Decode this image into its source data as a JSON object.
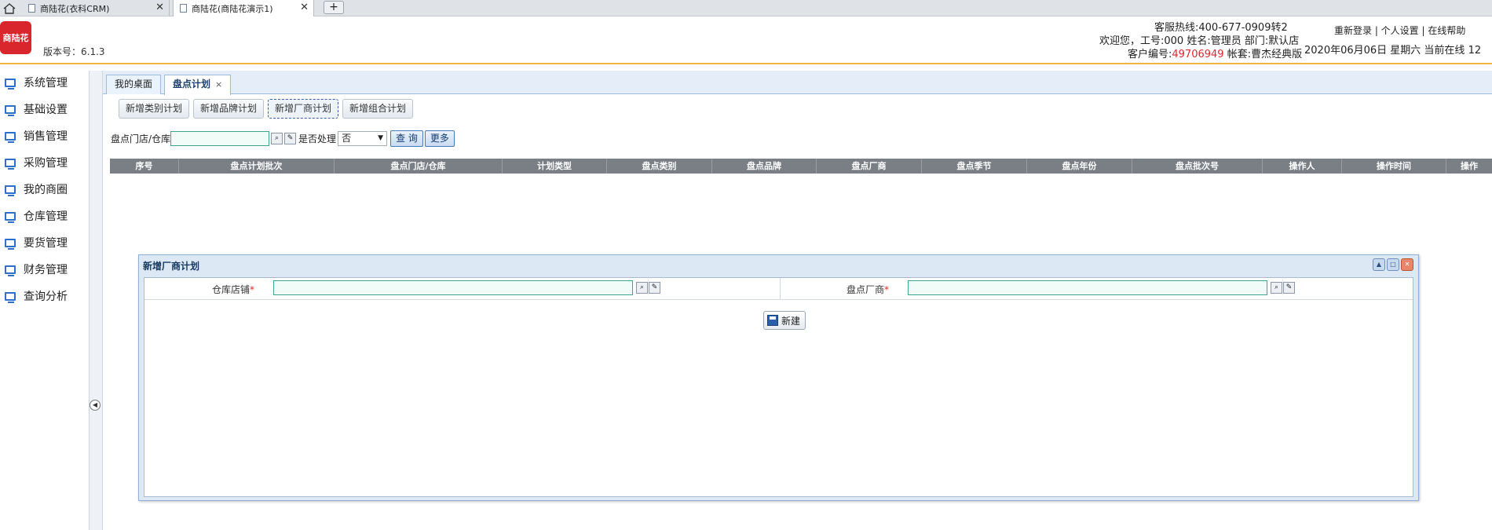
{
  "browser": {
    "tabs": [
      {
        "title": "商陆花(衣科CRM)"
      },
      {
        "title": "商陆花(商陆花演示1)"
      }
    ],
    "new_tab": "+"
  },
  "header": {
    "logo_text": "商陆花",
    "version": "版本号：6.1.3",
    "hotline": "客服热线:400-677-0909转2",
    "welcome": "欢迎您，工号:000 姓名:管理员 部门:默认店",
    "customer_prefix": "客户编号:",
    "customer_no": "49706949",
    "account": " 帐套:曹杰经典版",
    "links": "重新登录 | 个人设置 | 在线帮助",
    "datetime": "2020年06月06日 星期六 当前在线 12"
  },
  "nav": {
    "items": [
      "系统管理",
      "基础设置",
      "销售管理",
      "采购管理",
      "我的商圈",
      "仓库管理",
      "要货管理",
      "财务管理",
      "查询分析"
    ]
  },
  "app_tabs": {
    "desk": "我的桌面",
    "plan": "盘点计划",
    "close": "×"
  },
  "actions": [
    "新增类别计划",
    "新增品牌计划",
    "新增厂商计划",
    "新增组合计划"
  ],
  "filter": {
    "store_label": "盘点门店/仓库",
    "processed_label": "是否处理",
    "processed_value": "否",
    "query": "查 询",
    "more": "更多"
  },
  "grid": {
    "columns": [
      "序号",
      "盘点计划批次",
      "盘点门店/仓库",
      "计划类型",
      "盘点类别",
      "盘点品牌",
      "盘点厂商",
      "盘点季节",
      "盘点年份",
      "盘点批次号",
      "操作人",
      "操作时间",
      "操作"
    ]
  },
  "dialog": {
    "title": "新增厂商计划",
    "store_label": "仓库店铺",
    "vendor_label": "盘点厂商",
    "required": "*",
    "new_button": "新建"
  }
}
